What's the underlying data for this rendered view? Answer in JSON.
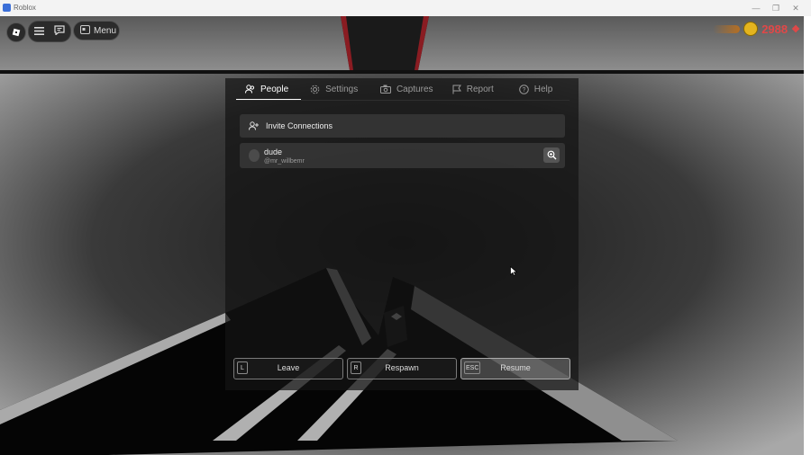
{
  "window": {
    "title": "Roblox",
    "controls": [
      "—",
      "❐",
      "✕"
    ]
  },
  "hud": {
    "menu_label": "Menu",
    "currency_value": "2988"
  },
  "tabs": [
    {
      "label": "People",
      "icon": "people-icon",
      "active": true
    },
    {
      "label": "Settings",
      "icon": "gear-icon",
      "active": false
    },
    {
      "label": "Captures",
      "icon": "camera-icon",
      "active": false
    },
    {
      "label": "Report",
      "icon": "flag-icon",
      "active": false
    },
    {
      "label": "Help",
      "icon": "help-icon",
      "active": false
    }
  ],
  "people": {
    "invite_label": "Invite Connections",
    "players": [
      {
        "display_name": "dude",
        "username": "@mr_willbemr"
      }
    ]
  },
  "actions": [
    {
      "key": "L",
      "label": "Leave"
    },
    {
      "key": "R",
      "label": "Respawn"
    },
    {
      "key": "ESC",
      "label": "Resume"
    }
  ],
  "colors": {
    "accent": "#ffffff",
    "currency": "#e04848",
    "panel": "#141414"
  }
}
